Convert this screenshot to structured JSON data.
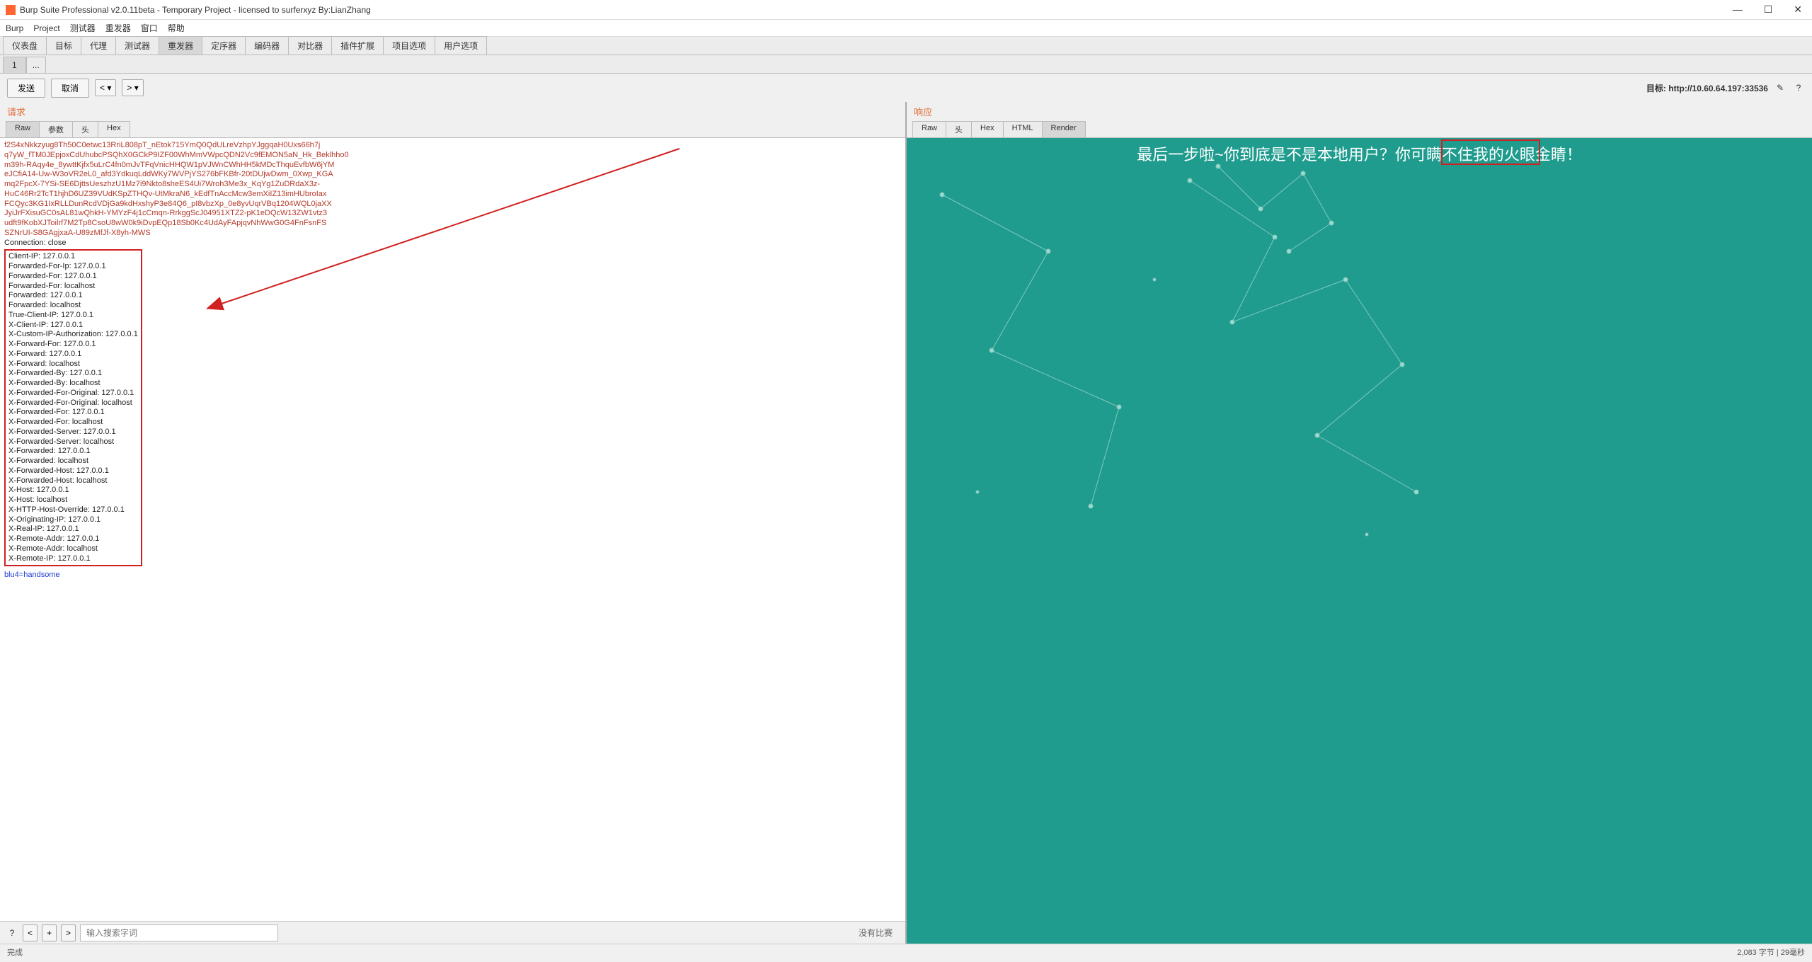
{
  "window": {
    "title": "Burp Suite Professional v2.0.11beta - Temporary Project - licensed to surferxyz By:LianZhang"
  },
  "menu": {
    "items": [
      "Burp",
      "Project",
      "测试器",
      "重发器",
      "窗口",
      "帮助"
    ]
  },
  "tabs": {
    "main": [
      "仪表盘",
      "目标",
      "代理",
      "测试器",
      "重发器",
      "定序器",
      "编码器",
      "对比器",
      "插件扩展",
      "项目选项",
      "用户选项"
    ],
    "active": "重发器",
    "sub": [
      "1",
      "..."
    ]
  },
  "toolbar": {
    "send": "发送",
    "cancel": "取消",
    "back": "<",
    "fwd": ">",
    "target_label": "目标: http://10.60.64.197:33536"
  },
  "request": {
    "label": "请求",
    "viewtabs": [
      "Raw",
      "参数",
      "头",
      "Hex"
    ],
    "active_view": "Raw",
    "red_lines": [
      "f2S4xNkkzyug8Th50C0etwc13RriL808pT_nEtok715YmQ0QdULreVzhpYJggqaH0Uxs66h7j",
      "q7yW_fTM0JEpjoxCdUhubcPSQhX0GCkP9IZF00WhMmVWpcQDN2Vc9fEMON5aN_Hk_Beklhho0",
      "m39h-RAqy4e_8ywttKjfx5uLrC4fn0mJvTFqVnicHHQW1pVJWnCWhHH5kMDcThquEvfbW6jYM",
      "eJCfiA14-Uw-W3oVR2eL0_afd3YdkuqLddWKy7WVPjYS276bFKBfr-20tDUjwDwm_0Xwp_KGA",
      "mq2FpcX-7YSi-SE6DjttsUeszhzU1Mz7i9Nkto8sheES4Ui7Wroh3Me3x_KqYg1ZuDRdaX3z-",
      "HuC46Rr2TcT1hjhD6UZ39VUdKSpZTHQv-UtMkraN6_kEdfTnAccMcw3emXiIZ13imHUbroIax",
      "FCQyc3KG1IxRLLDunRcdVDjGa9kdHxshyP3e84Q6_pI8vbzXp_0e8yvUqrVBq1204WQL0jaXX",
      "JyiJrFXisuGC0sAL81wQhkH-YMYzF4j1cCmqn-RrkggScJ04951XTZ2-pK1eDQcW13ZW1vtz3",
      "udft9fKobXJToilrf7M2Tp8CsoU8wW0k9iDvpEQp18Sb0Kc4UdAyFApjqvNhWwG0G4FnFsnFS",
      "SZNrUI-S8GAgjxaA-U89zMfJf-X8yh-MWS"
    ],
    "conn_line": "Connection: close",
    "headers": [
      "Client-IP: 127.0.0.1",
      "Forwarded-For-Ip: 127.0.0.1",
      "Forwarded-For: 127.0.0.1",
      "Forwarded-For: localhost",
      "Forwarded: 127.0.0.1",
      "Forwarded: localhost",
      "True-Client-IP: 127.0.0.1",
      "X-Client-IP: 127.0.0.1",
      "X-Custom-IP-Authorization: 127.0.0.1",
      "X-Forward-For: 127.0.0.1",
      "X-Forward: 127.0.0.1",
      "X-Forward: localhost",
      "X-Forwarded-By: 127.0.0.1",
      "X-Forwarded-By: localhost",
      "X-Forwarded-For-Original: 127.0.0.1",
      "X-Forwarded-For-Original: localhost",
      "X-Forwarded-For: 127.0.0.1",
      "X-Forwarded-For: localhost",
      "X-Forwarded-Server: 127.0.0.1",
      "X-Forwarded-Server: localhost",
      "X-Forwarded: 127.0.0.1",
      "X-Forwarded: localhost",
      "X-Forwarded-Host: 127.0.0.1",
      "X-Forwarded-Host: localhost",
      "X-Host: 127.0.0.1",
      "X-Host: localhost",
      "X-HTTP-Host-Override: 127.0.0.1",
      "X-Originating-IP: 127.0.0.1",
      "X-Real-IP: 127.0.0.1",
      "X-Remote-Addr: 127.0.0.1",
      "X-Remote-Addr: localhost",
      "X-Remote-IP: 127.0.0.1"
    ],
    "body": "blu4=handsome"
  },
  "response": {
    "label": "响应",
    "viewtabs": [
      "Raw",
      "头",
      "Hex",
      "HTML",
      "Render"
    ],
    "active_view": "Render",
    "banner": "最后一步啦~你到底是不是本地用户？你可瞒不住我的火眼金睛！"
  },
  "footer": {
    "help": "?",
    "nav_back": "<",
    "nav_add": "+",
    "nav_fwd": ">",
    "search_placeholder": "输入搜索字词",
    "nomatch": "没有比赛"
  },
  "statusbar": {
    "left": "完成",
    "right": "2,083 字节 | 29毫秒"
  }
}
